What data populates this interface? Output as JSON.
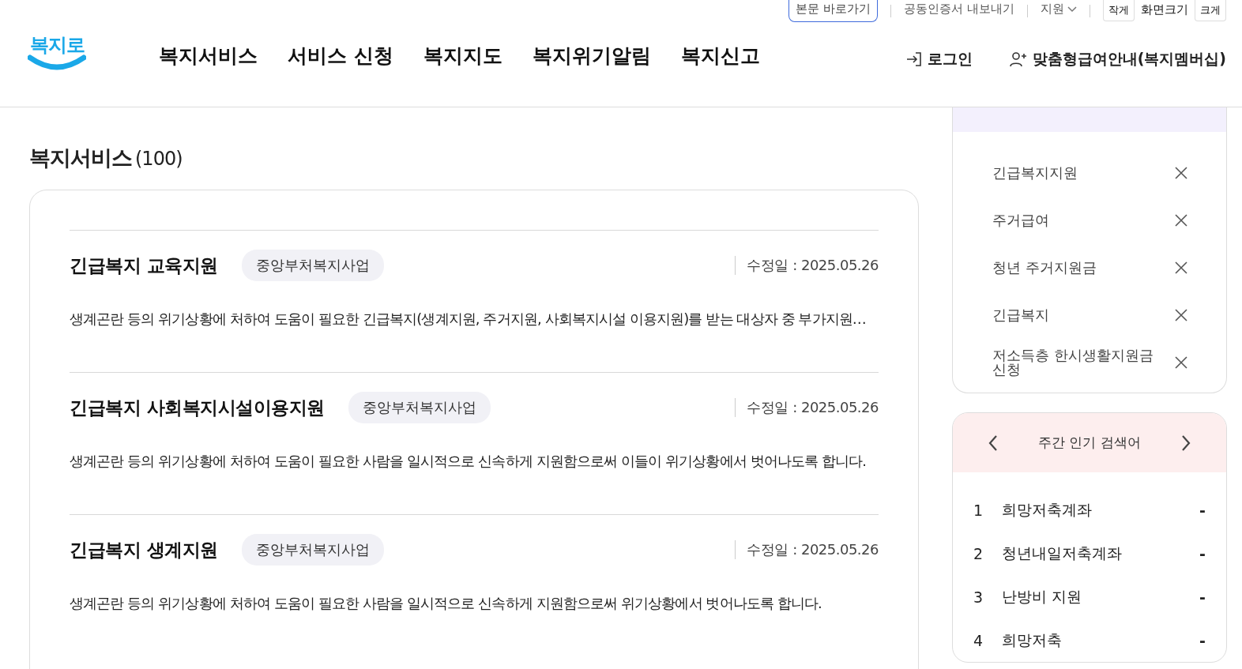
{
  "utility_bar": {
    "skip_link": "본문 바로가기",
    "links": [
      {
        "label": "공동인증서 내보내기",
        "kind": "link"
      },
      {
        "label": "지원",
        "kind": "dropdown"
      }
    ],
    "font_size": {
      "smaller": "작게",
      "label": "화면크기",
      "larger": "크게"
    }
  },
  "header": {
    "logo": "복지로",
    "nav": [
      "복지서비스",
      "서비스 신청",
      "복지지도",
      "복지위기알림",
      "복지신고"
    ],
    "login": "로그인",
    "membership": "맞춤형급여안내(복지멤버십)"
  },
  "results": {
    "title": "복지서비스",
    "count": "(100)",
    "items": [
      {
        "title": "긴급복지 교육지원",
        "tag": "중앙부처복지사업",
        "date_label": "수정일 :",
        "date": "2025.05.26",
        "description": "생계곤란 등의 위기상황에 처하여 도움이 필요한 긴급복지(생계지원, 주거지원, 사회복지시설 이용지원)를 받는 대상자 중 부가지원…"
      },
      {
        "title": "긴급복지 사회복지시설이용지원",
        "tag": "중앙부처복지사업",
        "date_label": "수정일 :",
        "date": "2025.05.26",
        "description": "생계곤란 등의 위기상황에 처하여 도움이 필요한 사람을 일시적으로 신속하게 지원함으로써 이들이 위기상황에서 벗어나도록 합니다."
      },
      {
        "title": "긴급복지 생계지원",
        "tag": "중앙부처복지사업",
        "date_label": "수정일 :",
        "date": "2025.05.26",
        "description": "생계곤란 등의 위기상황에 처하여 도움이 필요한 사람을 일시적으로 신속하게 지원함으로써 위기상황에서 벗어나도록 합니다."
      }
    ]
  },
  "recent_searches": {
    "items": [
      "긴급복지지원",
      "주거급여",
      "청년 주거지원금",
      "긴급복지",
      "저소득층 한시생활지원금 신청"
    ]
  },
  "popular_searches": {
    "title": "주간 인기 검색어",
    "items": [
      {
        "rank": "1",
        "term": "희망저축계좌",
        "trend": "-"
      },
      {
        "rank": "2",
        "term": "청년내일저축계좌",
        "trend": "-"
      },
      {
        "rank": "3",
        "term": "난방비 지원",
        "trend": "-"
      },
      {
        "rank": "4",
        "term": "희망저축",
        "trend": "-"
      }
    ]
  }
}
